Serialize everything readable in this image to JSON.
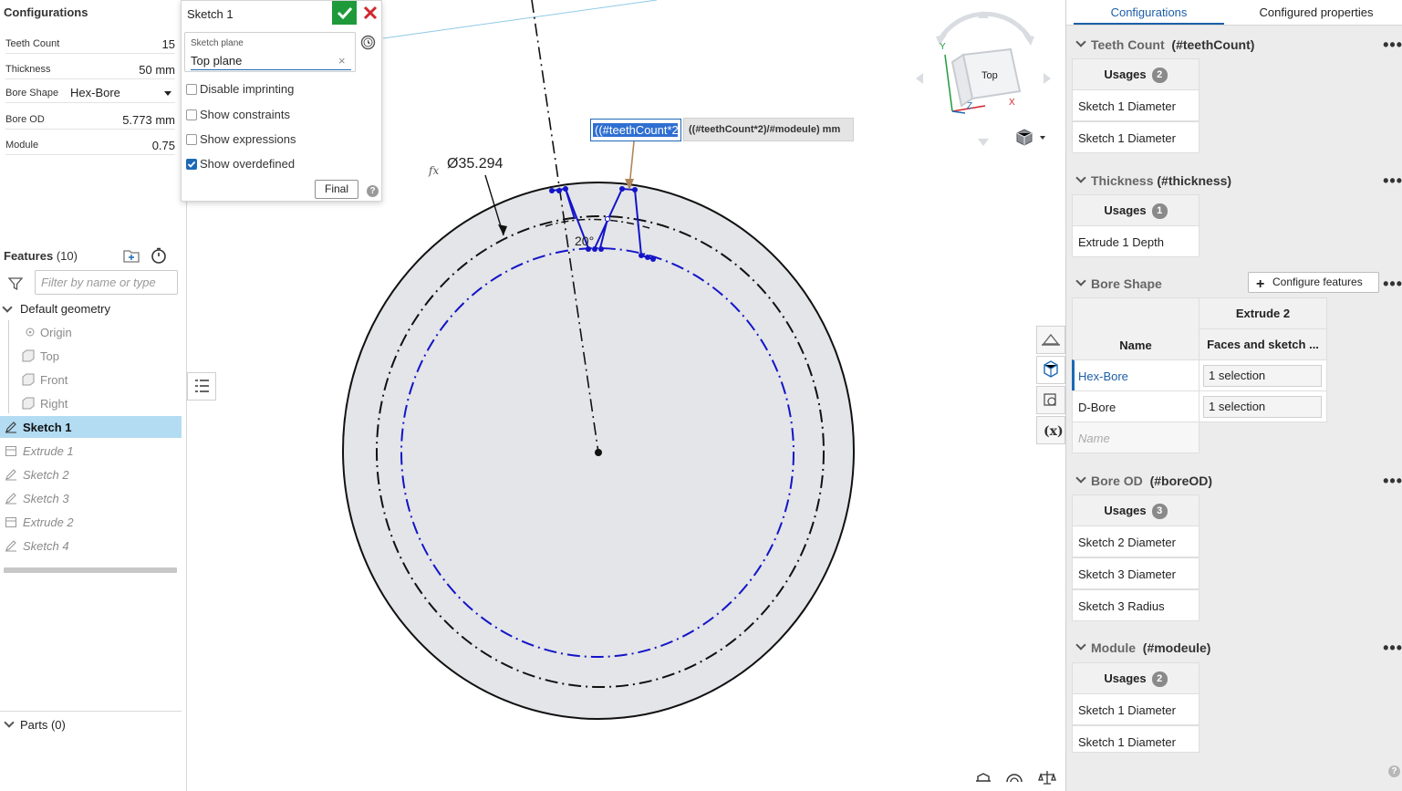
{
  "left_panel": {
    "title": "Configurations",
    "inputs": [
      {
        "label": "Teeth Count",
        "value": "15"
      },
      {
        "label": "Thickness",
        "value": "50 mm"
      },
      {
        "label": "Bore Shape",
        "value": "Hex-Bore"
      },
      {
        "label": "Bore OD",
        "value": "5.773 mm"
      },
      {
        "label": "Module",
        "value": "0.75"
      }
    ],
    "features": {
      "title": "Features",
      "count": "(10)",
      "filter_placeholder": "Filter by name or type",
      "group_label": "Default geometry",
      "items": [
        "Origin",
        "Top",
        "Front",
        "Right",
        "Sketch 1",
        "Extrude 1",
        "Sketch 2",
        "Sketch 3",
        "Extrude 2",
        "Sketch 4"
      ]
    },
    "parts": {
      "title": "Parts (0)"
    }
  },
  "sketch_dialog": {
    "title": "Sketch 1",
    "plane_label": "Sketch plane",
    "plane_value": "Top plane",
    "plane_clear": "×",
    "options": [
      {
        "label": "Disable imprinting",
        "checked": false
      },
      {
        "label": "Show constraints",
        "checked": false
      },
      {
        "label": "Show expressions",
        "checked": false
      },
      {
        "label": "Show overdefined",
        "checked": true
      }
    ],
    "final_button": "Final",
    "help": "?"
  },
  "canvas": {
    "expression_input": "((#teethCount*2",
    "expression_tooltip": "((#teethCount*2)/#modeule) mm",
    "diameter_dimension": "Ø35.294",
    "fx_marker": "fx",
    "angle_dimension": "20°",
    "view_cube_face": "Top",
    "axis_labels": {
      "x": "X",
      "y": "Y",
      "z": "Z"
    }
  },
  "right_panel": {
    "tabs": [
      "Configurations",
      "Configured properties"
    ],
    "sections": {
      "teeth": {
        "title": "Teeth Count",
        "id": "(#teethCount)",
        "usages_label": "Usages",
        "usages_count": "2",
        "rows": [
          "Sketch 1 Diameter",
          "Sketch 1 Diameter"
        ]
      },
      "thickness": {
        "title": "Thickness",
        "id": "(#thickness)",
        "usages_label": "Usages",
        "usages_count": "1",
        "rows": [
          "Extrude 1 Depth"
        ]
      },
      "bore_shape": {
        "title": "Bore Shape",
        "configure_button": "Configure features",
        "feature_header": "Extrude 2",
        "name_header": "Name",
        "param_header": "Faces and sketch ...",
        "rows": [
          {
            "name": "Hex-Bore",
            "value": "1 selection"
          },
          {
            "name": "D-Bore",
            "value": "1 selection"
          }
        ],
        "new_name_placeholder": "Name"
      },
      "bore_od": {
        "title": "Bore OD",
        "id": "(#boreOD)",
        "usages_label": "Usages",
        "usages_count": "3",
        "rows": [
          "Sketch 2 Diameter",
          "Sketch 3 Diameter",
          "Sketch 3 Radius"
        ]
      },
      "module": {
        "title": "Module",
        "id": "(#modeule)",
        "usages_label": "Usages",
        "usages_count": "2",
        "rows": [
          "Sketch 1 Diameter",
          "Sketch 1 Diameter"
        ]
      }
    },
    "more": "•••",
    "help": "?"
  },
  "colors": {
    "accent": "#1d69b6",
    "accept": "#1f9a3b",
    "cancel": "#d0262d",
    "sketch_blue": "#1414c8",
    "selection_bg": "#b3dcf3"
  }
}
